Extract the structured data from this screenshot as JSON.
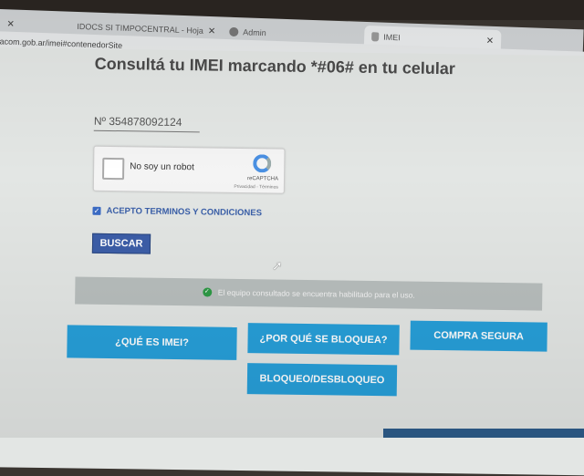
{
  "browser": {
    "tabs": [
      {
        "label": "IDOCS SI TIMPOCENTRAL - Hoja"
      },
      {
        "label": "Admin"
      },
      {
        "label": "IMEI"
      }
    ],
    "address": "acom.gob.ar/imei#contenedorSite"
  },
  "page": {
    "heading": "Consultá tu IMEI marcando *#06# en tu celular",
    "imei_value": "Nº 354878092124",
    "captcha": {
      "label": "No soy un robot",
      "brand": "reCAPTCHA",
      "links": "Privacidad - Términos"
    },
    "terms": {
      "label": "ACEPTO TERMINOS Y CONDICIONES",
      "checked": true
    },
    "search_button": "BUSCAR",
    "status_message": "El equipo consultado se encuentra habilitado para el uso.",
    "status_color": "#2e9a45",
    "buttons": {
      "que_es": "¿QUÉ ES IMEI?",
      "por_que": "¿POR QUÉ SE BLOQUEA?",
      "compra": "COMPRA SEGURA",
      "bloqueo": "BLOQUEO/DESBLOQUEO"
    },
    "accent_color": "#279fd9"
  }
}
